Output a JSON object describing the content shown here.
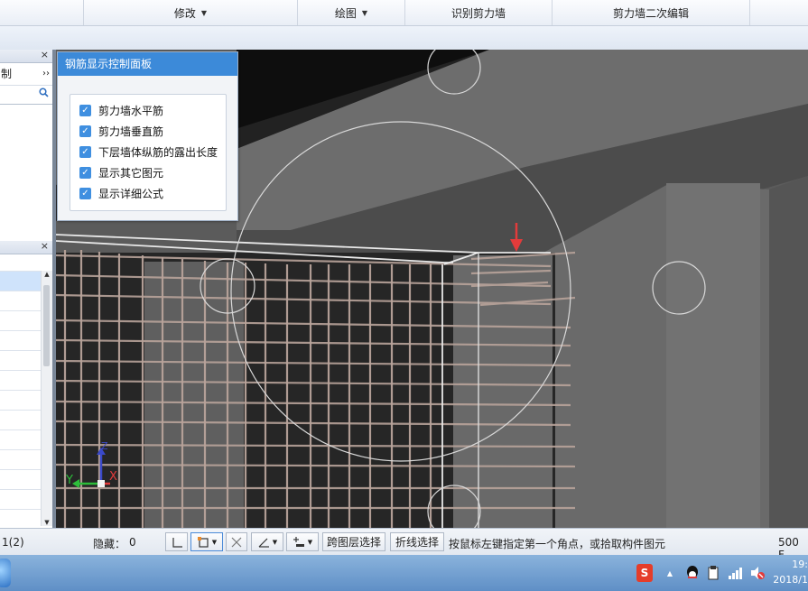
{
  "ribbon": {
    "groups": [
      {
        "label": "修改",
        "dropdown": true
      },
      {
        "label": "绘图",
        "dropdown": true
      },
      {
        "label": "识别剪力墙",
        "dropdown": false
      },
      {
        "label": "剪力墙二次编辑",
        "dropdown": false
      }
    ]
  },
  "left_pane": {
    "close_glyph": "×",
    "row_label": "制",
    "more_glyph": "››",
    "search_icon": "search-icon"
  },
  "left_pane2": {
    "close_glyph": "×"
  },
  "rebar_panel": {
    "title": "钢筋显示控制面板",
    "options": [
      {
        "label": "剪力墙水平筋",
        "checked": true
      },
      {
        "label": "剪力墙垂直筋",
        "checked": true
      },
      {
        "label": "下层墙体纵筋的露出长度",
        "checked": true
      },
      {
        "label": "显示其它图元",
        "checked": true
      },
      {
        "label": "显示详细公式",
        "checked": true
      }
    ]
  },
  "axes": {
    "x": "X",
    "y": "Y",
    "z": "Z"
  },
  "status_bar": {
    "count": "1(2)",
    "hidden_label": "隐藏：",
    "hidden_count": "0",
    "cross_layer_select": "跨图层选择",
    "polyline_select": "折线选择",
    "hint": "按鼠标左键指定第一个角点，或拾取构件图元",
    "fps": "500 F"
  },
  "taskbar": {
    "ime_label": "S",
    "time": "19:",
    "date": "2018/1"
  },
  "colors": {
    "panel_title": "#3c8ad9",
    "checkbox": "#3f8fe0",
    "arrow": "#e23b3b",
    "rebar": "#b8a39a"
  }
}
